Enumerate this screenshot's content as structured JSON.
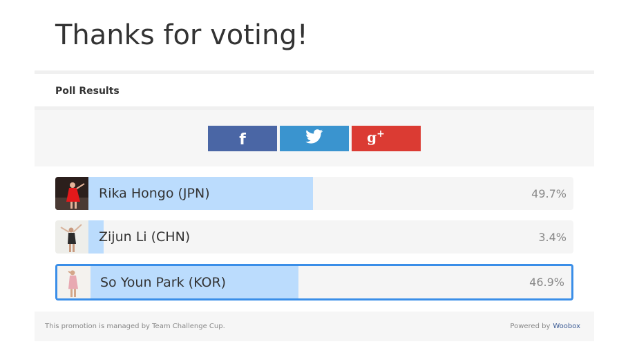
{
  "page": {
    "title": "Thanks for voting!",
    "results_label": "Poll Results"
  },
  "share": {
    "facebook": {
      "icon": "facebook-icon",
      "color": "#4a66a5"
    },
    "twitter": {
      "icon": "twitter-icon",
      "color": "#3a94cf"
    },
    "googleplus": {
      "icon": "google-plus-icon",
      "color": "#db3b33"
    }
  },
  "options": [
    {
      "label": "Rika Hongo (JPN)",
      "percent_text": "49.7%",
      "percent": 49.7,
      "selected": false,
      "thumb_icon": "skater-red-dress-photo"
    },
    {
      "label": "Zijun Li (CHN)",
      "percent_text": "3.4%",
      "percent": 3.4,
      "selected": false,
      "thumb_icon": "skater-dark-dress-photo"
    },
    {
      "label": "So Youn Park (KOR)",
      "percent_text": "46.9%",
      "percent": 46.9,
      "selected": true,
      "thumb_icon": "skater-pink-dress-photo"
    }
  ],
  "colors": {
    "bar_fill": "#bbdcfd",
    "selected_border": "#3a8ee8"
  },
  "footer": {
    "left_text": "This promotion is managed by Team Challenge Cup.",
    "powered_by": "Powered by",
    "brand_link": "Woobox"
  }
}
